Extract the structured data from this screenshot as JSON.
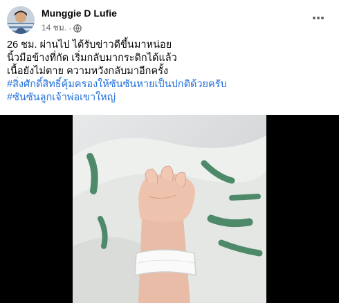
{
  "post": {
    "author": "Munggie D Lufie",
    "time": "14 ชม.",
    "separator": "·",
    "privacy_icon": "globe-icon",
    "more_icon": "more-horizontal-icon",
    "lines": [
      "26 ชม. ผ่านไป ได้รับข่าวดีขึ้นมาหน่อย",
      "นิ้วมือข้างที่กัด เริ่มกลับมากระดิกได้แล้ว",
      "เนื้อยังไม่ตาย ความหวังกลับมาอีกครั้ง"
    ],
    "hashtags": [
      "#สิ่งศักดิ์สิทธิ์คุ้มครองให้ซันซันหายเป็นปกติด้วยครับ",
      "#ซันซันลูกเจ้าพ่อเขาใหญ่"
    ]
  },
  "colors": {
    "text": "#050505",
    "meta": "#65676b",
    "hashtag": "#216fdb",
    "media_background": "#000000"
  }
}
